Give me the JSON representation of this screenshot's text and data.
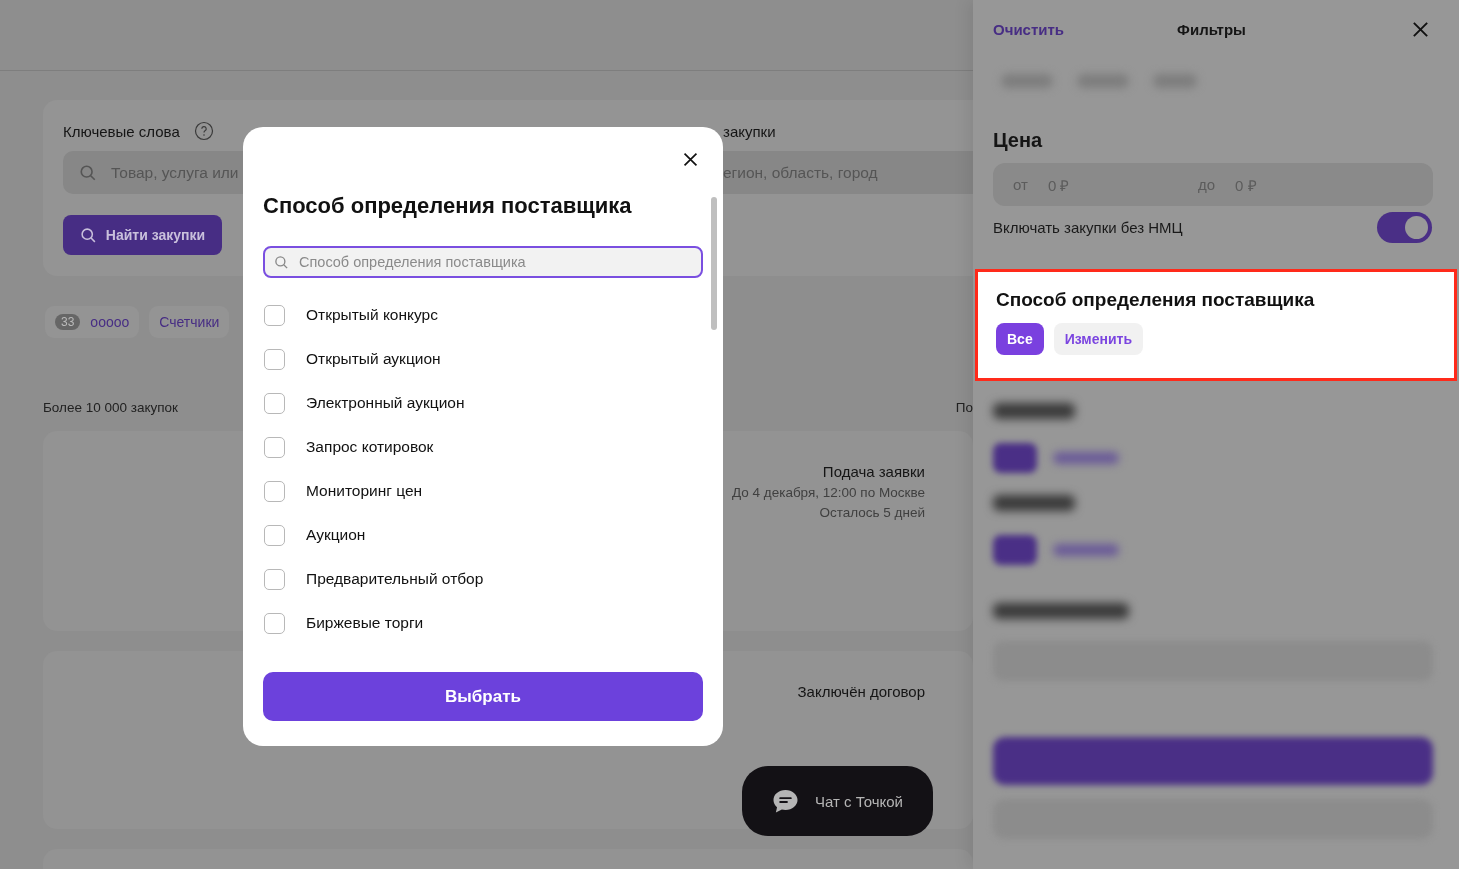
{
  "search_card": {
    "keywords_label": "Ключевые слова",
    "keywords_placeholder": "Товар, услуга или",
    "region_label": "закупки",
    "region_placeholder": "егион, область, город",
    "search_button": "Найти закупки"
  },
  "chips": [
    {
      "kind": "counted",
      "count": "33",
      "label": "ooooo"
    },
    {
      "kind": "plain",
      "label": "Счетчики"
    }
  ],
  "results": {
    "count": "Более 10 000 закупок",
    "sort": "По"
  },
  "cards": [
    {
      "status": "Подача заявки",
      "lines": [
        "До 4 декабря, 12:00 по Москве",
        "Осталось 5 дней"
      ]
    },
    {
      "status": "Заключён договор"
    }
  ],
  "chat_button": "Чат с Точкой",
  "filters": {
    "clear": "Очистить",
    "title": "Фильтры",
    "price": {
      "heading": "Цена",
      "from_label": "от",
      "from_placeholder": "0 ₽",
      "to_label": "до",
      "to_placeholder": "0 ₽"
    },
    "no_nmc": {
      "label": "Включать закупки без НМЦ",
      "on": true
    },
    "supplier_method": {
      "heading": "Способ определения поставщика",
      "highlighted": true,
      "buttons": [
        {
          "label": "Все",
          "selected": true
        },
        {
          "label": "Изменить",
          "selected": false
        }
      ]
    }
  },
  "modal": {
    "title": "Способ определения поставщика",
    "search_placeholder": "Способ определения поставщика",
    "options": [
      {
        "label": "Открытый конкурс",
        "checked": false
      },
      {
        "label": "Открытый аукцион",
        "checked": false
      },
      {
        "label": "Электронный аукцион",
        "checked": false
      },
      {
        "label": "Запрос котировок",
        "checked": false
      },
      {
        "label": "Мониторинг цен",
        "checked": false
      },
      {
        "label": "Аукцион",
        "checked": false
      },
      {
        "label": "Предварительный отбор",
        "checked": false
      },
      {
        "label": "Биржевые торги",
        "checked": false
      }
    ],
    "submit": "Выбрать"
  }
}
